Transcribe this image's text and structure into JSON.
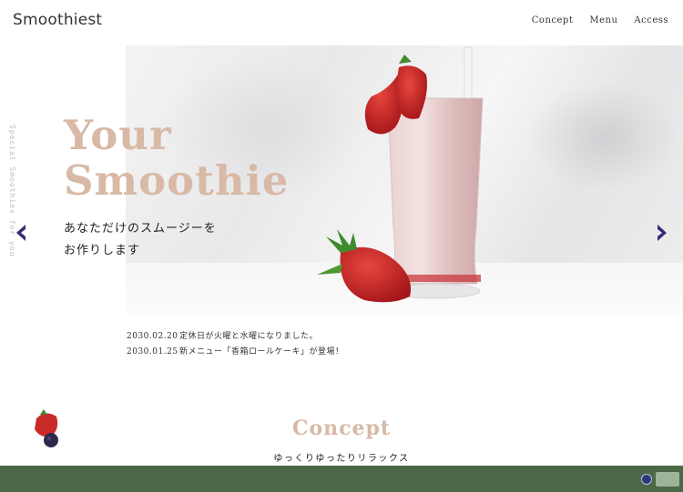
{
  "header": {
    "logo": "Smoothiest",
    "nav": [
      {
        "label": "Concept"
      },
      {
        "label": "Menu"
      },
      {
        "label": "Access"
      }
    ]
  },
  "hero": {
    "side_text": "Special Smoothies for you",
    "title_line1": "Your",
    "title_line2": "Smoothie",
    "subtitle_line1": "あなただけのスムージーを",
    "subtitle_line2": "お作りします"
  },
  "news": [
    {
      "date": "2030.02.20",
      "text": "定休日が火曜と水曜になりました。"
    },
    {
      "date": "2030.01.25",
      "text": "新メニュー「香箱ロールケーキ」が登場！"
    }
  ],
  "concept": {
    "title": "Concept",
    "subtitle": "ゆっくりゆったりリラックス"
  },
  "colors": {
    "accent": "#d8b9a6",
    "arrow": "#3a2a78",
    "footer": "#4b6947"
  }
}
